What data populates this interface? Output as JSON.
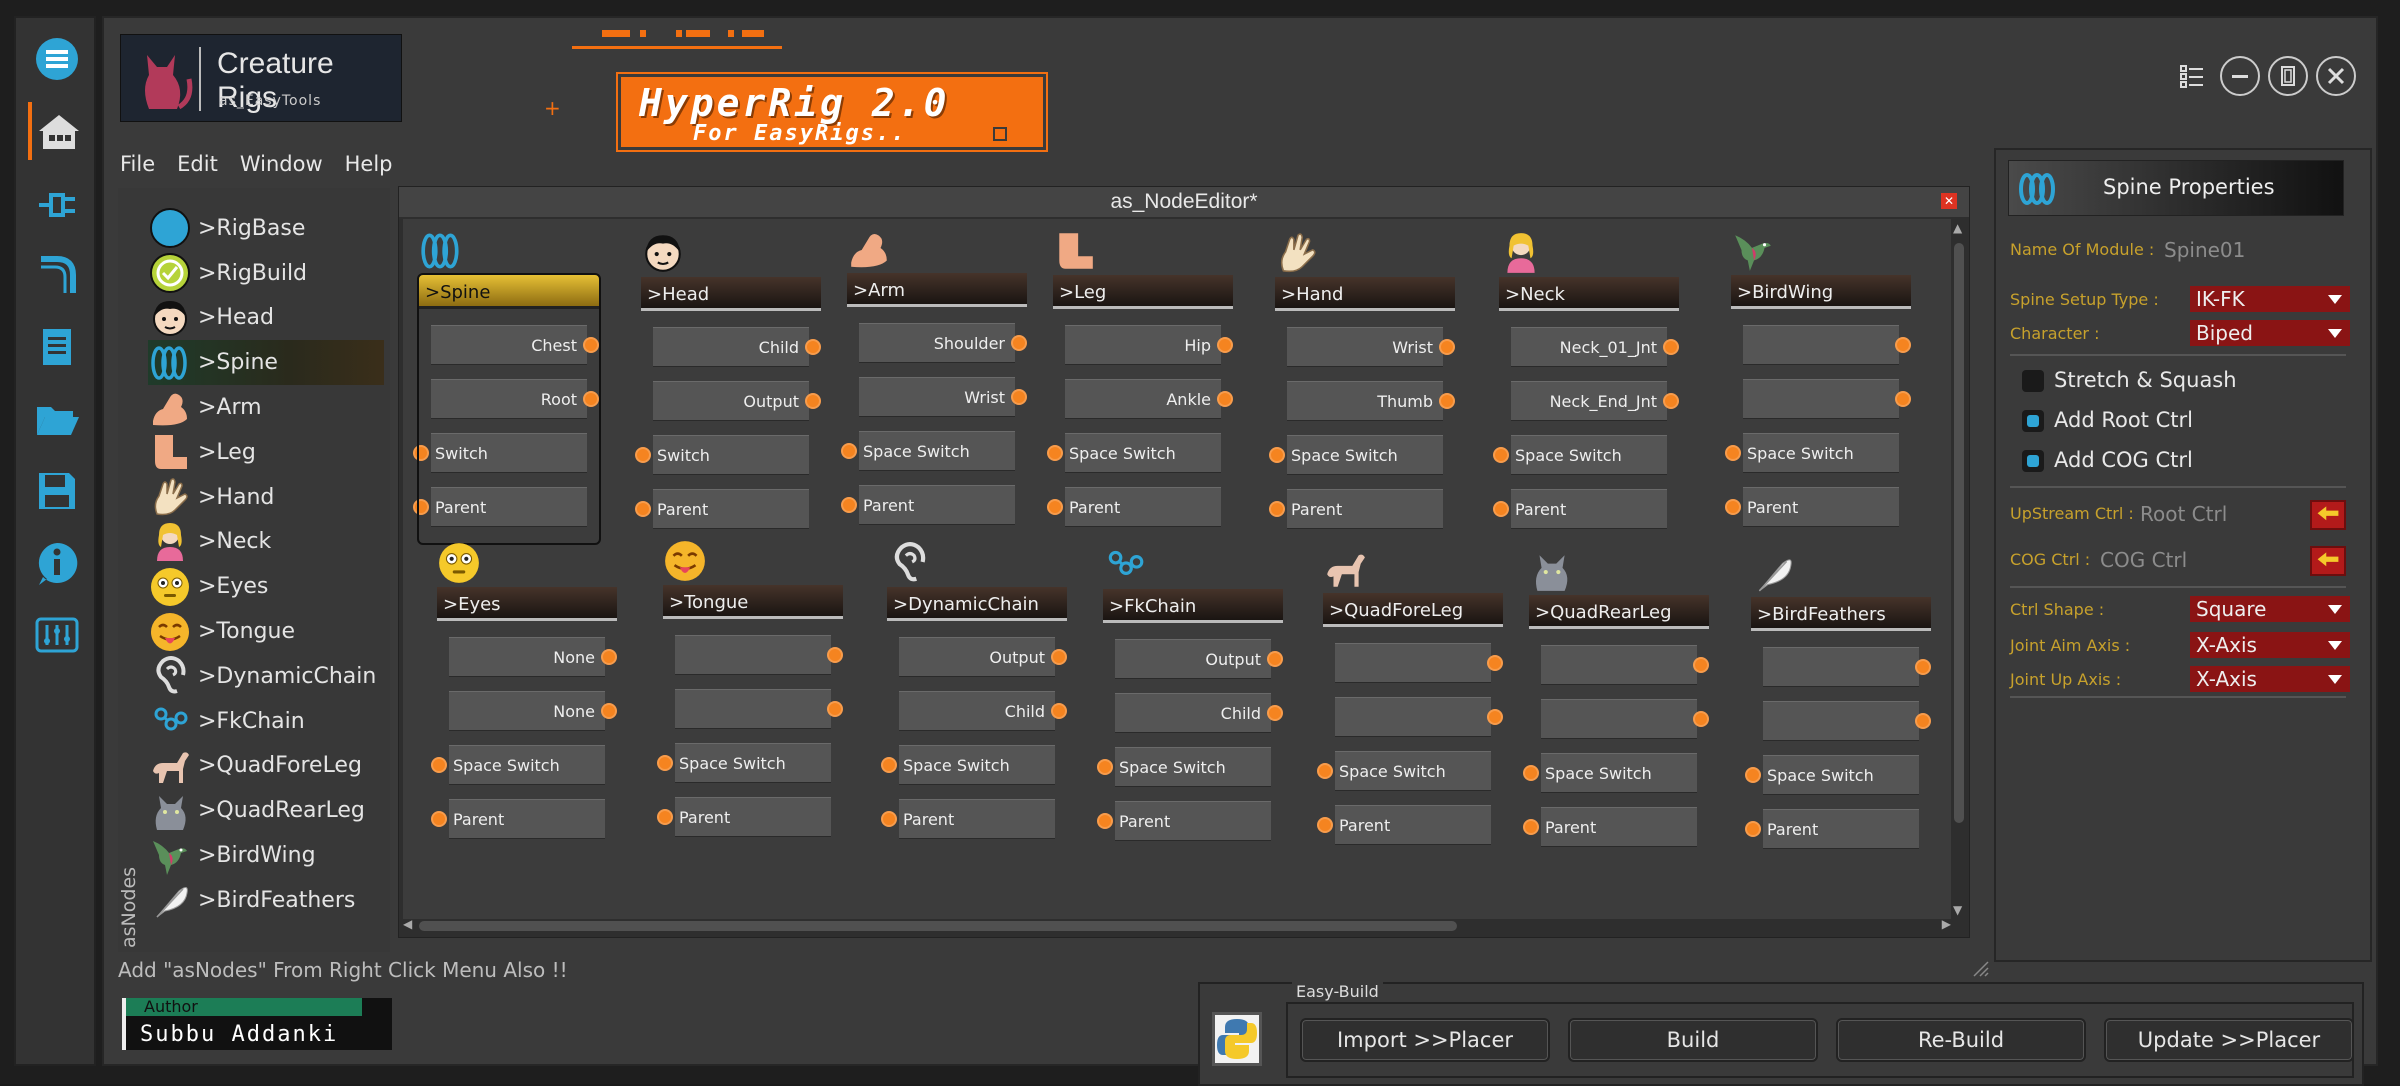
{
  "app": {
    "logo_title": "Creature Rigs",
    "logo_subtitle": "as_EasyTools",
    "banner_title": "HyperRig 2.0",
    "banner_subtitle": "For EasyRigs..",
    "accent": "#f36f11"
  },
  "menu": [
    "File",
    "Edit",
    "Window",
    "Help"
  ],
  "left_toolbar": [
    "menu-icon",
    "home-icon",
    "plug-icon",
    "pipe-icon",
    "document-icon",
    "folder-icon",
    "save-icon",
    "info-icon",
    "settings-sliders-icon"
  ],
  "asnodes": {
    "panel_label": "asNodes",
    "items": [
      {
        "label": ">RigBase",
        "icon": "blue-circle-icon"
      },
      {
        "label": ">RigBuild",
        "icon": "check-circle-icon"
      },
      {
        "label": ">Head",
        "icon": "face-icon"
      },
      {
        "label": ">Spine",
        "icon": "spine-coil-icon",
        "selected": true
      },
      {
        "label": ">Arm",
        "icon": "arm-icon"
      },
      {
        "label": ">Leg",
        "icon": "leg-icon"
      },
      {
        "label": ">Hand",
        "icon": "hand-icon"
      },
      {
        "label": ">Neck",
        "icon": "person-icon"
      },
      {
        "label": ">Eyes",
        "icon": "eyes-emoji-icon"
      },
      {
        "label": ">Tongue",
        "icon": "tongue-emoji-icon"
      },
      {
        "label": ">DynamicChain",
        "icon": "ear-icon"
      },
      {
        "label": ">FkChain",
        "icon": "chain-icon"
      },
      {
        "label": ">QuadForeLeg",
        "icon": "horse-icon"
      },
      {
        "label": ">QuadRearLeg",
        "icon": "cat-icon"
      },
      {
        "label": ">BirdWing",
        "icon": "bird-icon"
      },
      {
        "label": ">BirdFeathers",
        "icon": "feather-icon"
      }
    ]
  },
  "hint": "Add \"asNodes\" From Right Click Menu Also !!",
  "editor": {
    "title": "as_NodeEditor*",
    "nodes": [
      {
        "title": ">Spine",
        "icon": "spine-coil-icon",
        "outputs": [
          "Chest",
          "Root"
        ],
        "inputs": [
          "Switch",
          "Parent"
        ],
        "selected": true
      },
      {
        "title": ">Head",
        "icon": "face-icon",
        "outputs": [
          "Child",
          "Output"
        ],
        "inputs": [
          "Switch",
          "Parent"
        ]
      },
      {
        "title": ">Arm",
        "icon": "arm-icon",
        "outputs": [
          "Shoulder",
          "Wrist"
        ],
        "inputs": [
          "Space Switch",
          "Parent"
        ]
      },
      {
        "title": ">Leg",
        "icon": "leg-icon",
        "outputs": [
          "Hip",
          "Ankle"
        ],
        "inputs": [
          "Space Switch",
          "Parent"
        ]
      },
      {
        "title": ">Hand",
        "icon": "hand-icon",
        "outputs": [
          "Wrist",
          "Thumb"
        ],
        "inputs": [
          "Space Switch",
          "Parent"
        ]
      },
      {
        "title": ">Neck",
        "icon": "person-icon",
        "outputs": [
          "Neck_01_Jnt",
          "Neck_End_Jnt"
        ],
        "inputs": [
          "Space Switch",
          "Parent"
        ]
      },
      {
        "title": ">BirdWing",
        "icon": "bird-icon",
        "outputs": [
          "",
          ""
        ],
        "inputs": [
          "Space Switch",
          "Parent"
        ]
      },
      {
        "title": ">Eyes",
        "icon": "eyes-emoji-icon",
        "outputs": [
          "None",
          "None"
        ],
        "inputs": [
          "Space Switch",
          "Parent"
        ]
      },
      {
        "title": ">Tongue",
        "icon": "tongue-emoji-icon",
        "outputs": [
          "",
          ""
        ],
        "inputs": [
          "Space Switch",
          "Parent"
        ]
      },
      {
        "title": ">DynamicChain",
        "icon": "ear-icon",
        "outputs": [
          "Output",
          "Child"
        ],
        "inputs": [
          "Space Switch",
          "Parent"
        ]
      },
      {
        "title": ">FkChain",
        "icon": "chain-icon",
        "outputs": [
          "Output",
          "Child"
        ],
        "inputs": [
          "Space Switch",
          "Parent"
        ]
      },
      {
        "title": ">QuadForeLeg",
        "icon": "horse-icon",
        "outputs": [
          "",
          ""
        ],
        "inputs": [
          "Space Switch",
          "Parent"
        ]
      },
      {
        "title": ">QuadRearLeg",
        "icon": "cat-icon",
        "outputs": [
          "",
          ""
        ],
        "inputs": [
          "Space Switch",
          "Parent"
        ]
      },
      {
        "title": ">BirdFeathers",
        "icon": "feather-icon",
        "outputs": [
          "",
          ""
        ],
        "inputs": [
          "Space Switch",
          "Parent"
        ]
      }
    ]
  },
  "properties": {
    "title": "Spine Properties",
    "module_name_label": "Name Of Module :",
    "module_name_value": "Spine01",
    "setup_type_label": "Spine Setup Type :",
    "setup_type_value": "IK-FK",
    "character_label": "Character :",
    "character_value": "Biped",
    "stretch_label": "Stretch & Squash",
    "stretch_checked": false,
    "root_ctrl_label": "Add Root Ctrl",
    "root_ctrl_checked": true,
    "cog_ctrl_label": "Add COG Ctrl",
    "cog_ctrl_checked": true,
    "upstream_label": "UpStream Ctrl :",
    "upstream_value": "Root Ctrl",
    "cog_label": "COG Ctrl :",
    "cog_value": "COG Ctrl",
    "shape_label": "Ctrl Shape :",
    "shape_value": "Square",
    "aim_label": "Joint Aim Axis :",
    "aim_value": "X-Axis",
    "up_label": "Joint Up Axis :",
    "up_value": "X-Axis",
    "label_color": "#c7a12c",
    "dropdown_color": "#8a1414"
  },
  "author": {
    "label": "Author",
    "name": "Subbu Addanki"
  },
  "easybuild": {
    "label": "Easy-Build",
    "buttons": [
      "Import >>Placer",
      "Build",
      "Re-Build",
      "Update >>Placer"
    ]
  }
}
